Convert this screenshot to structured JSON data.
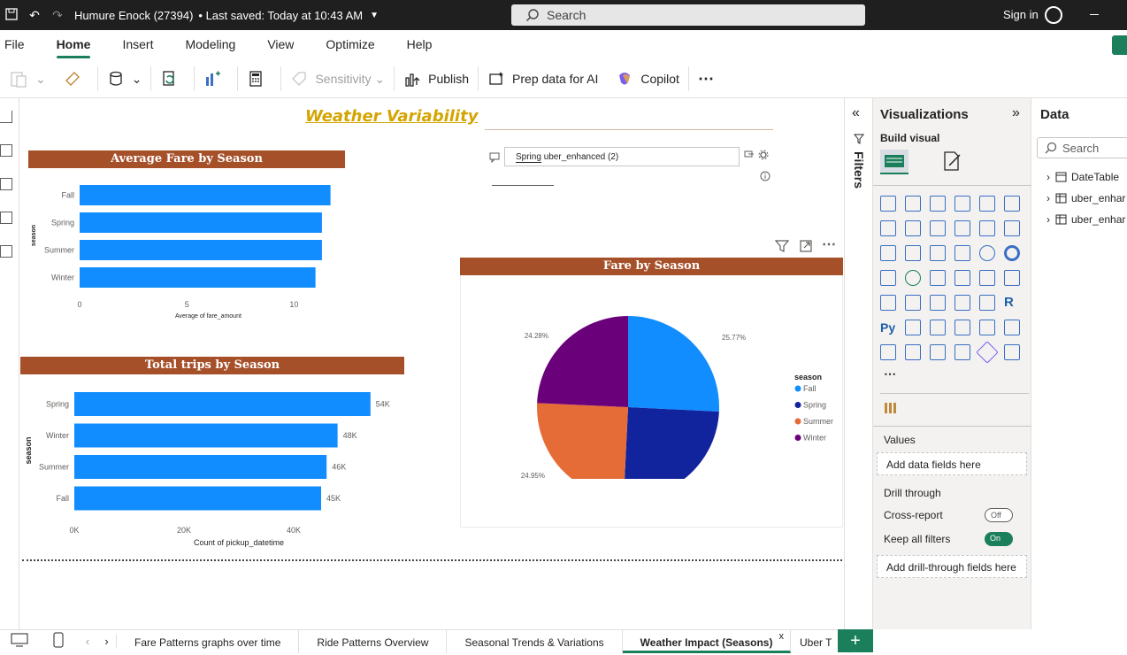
{
  "titlebar": {
    "doc_title": "Humure Enock (27394)",
    "saved": "• Last saved: Today at 10:43 AM",
    "search_placeholder": "Search",
    "signin": "Sign in"
  },
  "menu": {
    "items": [
      "File",
      "Home",
      "Insert",
      "Modeling",
      "View",
      "Optimize",
      "Help"
    ],
    "active": "Home"
  },
  "ribbon": {
    "sensitivity": "Sensitivity",
    "publish": "Publish",
    "prep_data": "Prep data for AI",
    "copilot": "Copilot",
    "more": "⋯"
  },
  "report": {
    "title": "Weather Variability",
    "slicer_value": "Spring",
    "slicer_source": "uber_enhanced (2)"
  },
  "chart_data": [
    {
      "type": "bar",
      "title": "Average Fare by Season",
      "categories": [
        "Fall",
        "Spring",
        "Summer",
        "Winter"
      ],
      "values": [
        11.7,
        11.3,
        11.3,
        11.0
      ],
      "xlabel": "Average of fare_amount",
      "ylabel": "season",
      "xticks": [
        "0",
        "5",
        "10"
      ],
      "xlim": [
        0,
        12.5
      ]
    },
    {
      "type": "bar",
      "title": "Total trips by Season",
      "categories": [
        "Spring",
        "Winter",
        "Summer",
        "Fall"
      ],
      "values": [
        54000,
        48000,
        46000,
        45000
      ],
      "data_labels": [
        "54K",
        "48K",
        "46K",
        "45K"
      ],
      "xlabel": "Count of pickup_datetime",
      "ylabel": "season",
      "xticks": [
        "0K",
        "20K",
        "40K"
      ],
      "xlim": [
        0,
        60000
      ]
    },
    {
      "type": "pie",
      "title": "Fare by Season",
      "legend_title": "season",
      "legend_position": "right",
      "series": [
        {
          "name": "Fall",
          "value": 25.77,
          "label": "25.77%",
          "color": "#118dff"
        },
        {
          "name": "Spring",
          "value": 25.0,
          "label": "",
          "color": "#12239e"
        },
        {
          "name": "Summer",
          "value": 24.95,
          "label": "24.95%",
          "color": "#e66c37"
        },
        {
          "name": "Winter",
          "value": 24.28,
          "label": "24.28%",
          "color": "#6b007b"
        }
      ]
    }
  ],
  "panes": {
    "filters_label": "Filters",
    "visualizations_title": "Visualizations",
    "build_visual": "Build visual",
    "more_visuals": "⋯",
    "values_label": "Values",
    "values_placeholder": "Add data fields here",
    "drill_through": "Drill through",
    "cross_report": "Cross-report",
    "cross_report_state": "Off",
    "keep_filters": "Keep all filters",
    "keep_filters_state": "On",
    "drill_placeholder": "Add drill-through fields here",
    "data_title": "Data",
    "data_search": "Search",
    "data_items": [
      "DateTable",
      "uber_enhar",
      "uber_enhar"
    ]
  },
  "tabs": {
    "items": [
      "Fare Patterns graphs over time",
      "Ride Patterns Overview",
      "Seasonal Trends & Variations",
      "Weather Impact (Seasons)",
      "Uber T"
    ],
    "active": "Weather Impact (Seasons)",
    "add": "+"
  },
  "colors": {
    "bar": "#118dff",
    "header": "#a6502a",
    "accent": "#1a7f5a",
    "title": "#d4a400"
  }
}
